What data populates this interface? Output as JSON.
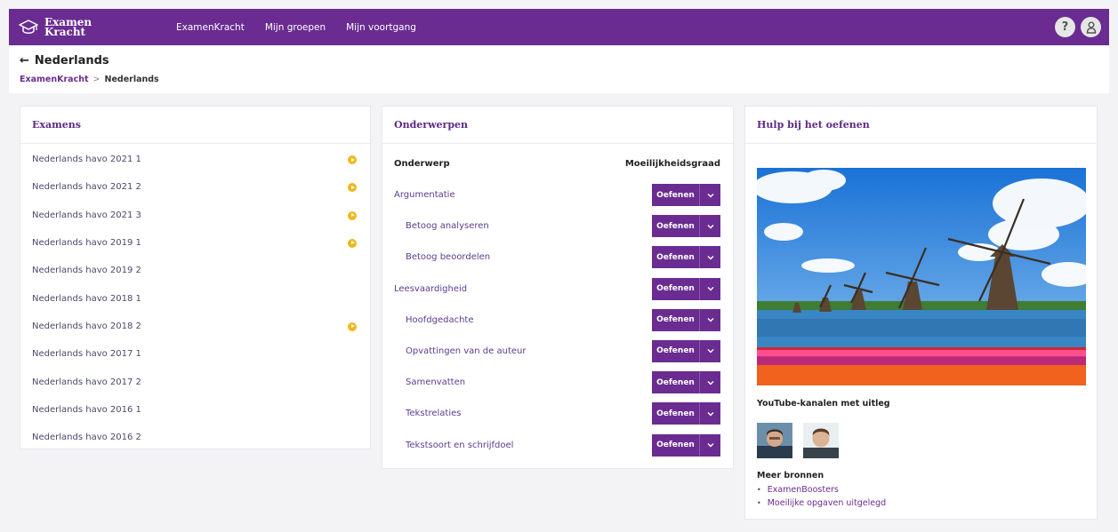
{
  "brand": {
    "line1": "Examen",
    "line2": "Kracht"
  },
  "nav": [
    "ExamenKracht",
    "Mijn groepen",
    "Mijn voortgang"
  ],
  "header": {
    "back_arrow": "←",
    "title": "Nederlands",
    "breadcrumb": [
      "ExamenKracht",
      "Nederlands"
    ],
    "breadcrumb_sep": ">"
  },
  "help_icon": "?",
  "exams": {
    "heading": "Examens",
    "items": [
      {
        "label": "Nederlands havo 2021 1",
        "marked": true
      },
      {
        "label": "Nederlands havo 2021 2",
        "marked": true
      },
      {
        "label": "Nederlands havo 2021 3",
        "marked": true
      },
      {
        "label": "Nederlands havo 2019 1",
        "marked": true
      },
      {
        "label": "Nederlands havo 2019 2",
        "marked": false
      },
      {
        "label": "Nederlands havo 2018 1",
        "marked": false
      },
      {
        "label": "Nederlands havo 2018 2",
        "marked": true
      },
      {
        "label": "Nederlands havo 2017 1",
        "marked": false
      },
      {
        "label": "Nederlands havo 2017 2",
        "marked": false
      },
      {
        "label": "Nederlands havo 2016 1",
        "marked": false
      },
      {
        "label": "Nederlands havo 2016 2",
        "marked": false
      }
    ]
  },
  "topics": {
    "heading": "Onderwerpen",
    "col_topic": "Onderwerp",
    "col_difficulty": "Moeilijkheidsgraad",
    "button_label": "Oefenen",
    "items": [
      {
        "label": "Argumentatie",
        "sub": false
      },
      {
        "label": "Betoog analyseren",
        "sub": true
      },
      {
        "label": "Betoog beoordelen",
        "sub": true
      },
      {
        "label": "Leesvaardigheid",
        "sub": false
      },
      {
        "label": "Hoofdgedachte",
        "sub": true
      },
      {
        "label": "Opvattingen van de auteur",
        "sub": true
      },
      {
        "label": "Samenvatten",
        "sub": true
      },
      {
        "label": "Tekstrelaties",
        "sub": true
      },
      {
        "label": "Tekstsoort en schrijfdoel",
        "sub": true
      }
    ]
  },
  "help": {
    "heading": "Hulp bij het oefenen",
    "youtube_title": "YouTube-kanalen met uitleg",
    "more_title": "Meer bronnen",
    "resources": [
      "ExamenBoosters",
      "Moeilijke opgaven uitgelegd"
    ]
  },
  "colors": {
    "brand_purple": "#6a2c91",
    "marker_yellow": "#f0b81a"
  }
}
